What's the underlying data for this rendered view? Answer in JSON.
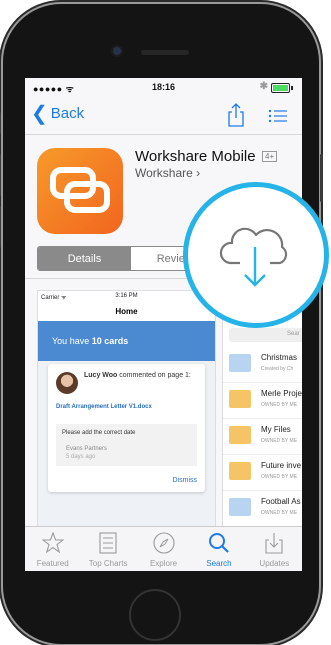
{
  "status_bar": {
    "carrier": "●●●●● ᯤ",
    "time": "18:16",
    "bluetooth": "✱"
  },
  "nav": {
    "back_label": "Back",
    "back_chevron": "❮"
  },
  "app": {
    "title": "Workshare Mobile",
    "age_rating": "4+",
    "developer": "Workshare",
    "developer_chevron": "›"
  },
  "segments": {
    "details": "Details",
    "reviews": "Reviews"
  },
  "screenshot1": {
    "carrier": "Carrier ᯤ",
    "time": "3:16 PM",
    "nav_title": "Home",
    "banner_prefix": "You have ",
    "banner_count": "10 cards",
    "card_user": "Lucy Woo",
    "card_action": " commented on page 1:",
    "card_doc": "Draft Arrangement Letter V1.docx",
    "card_comment": "Please add the correct date",
    "card_author": "Evans Partners",
    "card_time": "5 days ago",
    "card_dismiss": "Dismiss"
  },
  "screenshot2": {
    "title": "Fo",
    "search": "Sear",
    "rows": [
      {
        "name": "Christmas",
        "sub": "Created by Ch"
      },
      {
        "name": "Merle Proje",
        "sub": "OWNED BY ME"
      },
      {
        "name": "My Files",
        "sub": "OWNED BY ME"
      },
      {
        "name": "Future inve",
        "sub": "OWNED BY ME"
      },
      {
        "name": "Football As",
        "sub": "OWNED BY ME"
      }
    ]
  },
  "tabbar": {
    "featured": "Featured",
    "top_charts": "Top Charts",
    "explore": "Explore",
    "search": "Search",
    "updates": "Updates"
  },
  "colors": {
    "accent": "#1e7be5",
    "app_icon": "#f4781f",
    "cloud_ring": "#25b3e8"
  },
  "icons": [
    "share-icon",
    "list-icon",
    "cloud-download-icon",
    "star-icon",
    "list-icon",
    "compass-icon",
    "search-icon",
    "download-tray-icon"
  ]
}
